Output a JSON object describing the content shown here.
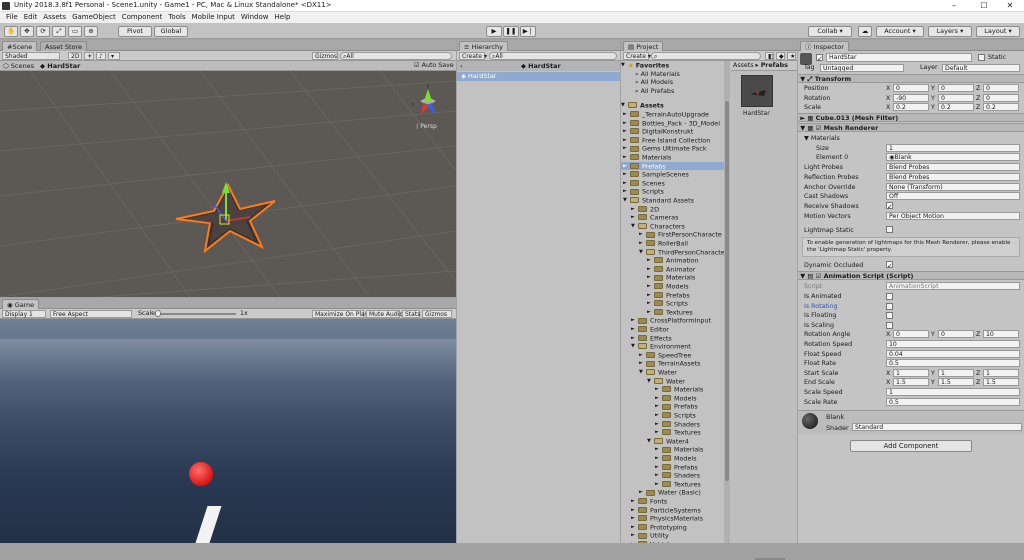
{
  "window": {
    "title": "Unity 2018.3.8f1 Personal - Scene1.unity - Game1 - PC, Mac & Linux Standalone* <DX11>"
  },
  "menu": [
    "File",
    "Edit",
    "Assets",
    "GameObject",
    "Component",
    "Tools",
    "Mobile Input",
    "Window",
    "Help"
  ],
  "toolbar": {
    "pivot": "Pivot",
    "global": "Global",
    "collab": "Collab",
    "account": "Account",
    "layers": "Layers",
    "layout": "Layout"
  },
  "scene": {
    "tab_scene": "Scene",
    "tab_asset_store": "Asset Store",
    "shaded": "Shaded",
    "mode_2d": "2D",
    "gizmos": "Gizmos",
    "search": "All",
    "scenes": "Scenes",
    "breadcrumb": "HardStar",
    "auto_save": "Auto Save",
    "persp": "Persp",
    "axis_y": "y",
    "axis_x": "x"
  },
  "game": {
    "tab": "Game",
    "display": "Display 1",
    "aspect": "Free Aspect",
    "scale_label": "Scale",
    "scale_value": "1x",
    "maximize": "Maximize On Play",
    "mute": "Mute Audio",
    "stats": "Stats",
    "gizmos": "Gizmos"
  },
  "hierarchy": {
    "tab": "Hierarchy",
    "create": "Create",
    "search": "All",
    "scene_name": "HardStar",
    "item": "HardStar"
  },
  "project": {
    "tab": "Project",
    "create": "Create",
    "favorites": "Favorites",
    "fav_items": [
      "All Materials",
      "All Models",
      "All Prefabs"
    ],
    "assets": "Assets",
    "tree": [
      {
        "l": "_TerrainAutoUpgrade",
        "d": 1
      },
      {
        "l": "Bottles_Pack - 3D_Model",
        "d": 1
      },
      {
        "l": "DigitalKonstrukt",
        "d": 1
      },
      {
        "l": "Free Island Collection",
        "d": 1
      },
      {
        "l": "Gems Ultimate Pack",
        "d": 1
      },
      {
        "l": "Materials",
        "d": 1
      },
      {
        "l": "Prefabs",
        "d": 1,
        "sel": true
      },
      {
        "l": "SampleScenes",
        "d": 1
      },
      {
        "l": "Scenes",
        "d": 1
      },
      {
        "l": "Scripts",
        "d": 1
      },
      {
        "l": "Standard Assets",
        "d": 1,
        "open": true
      },
      {
        "l": "2D",
        "d": 2
      },
      {
        "l": "Cameras",
        "d": 2
      },
      {
        "l": "Characters",
        "d": 2,
        "open": true
      },
      {
        "l": "FirstPersonCharacte",
        "d": 3
      },
      {
        "l": "RollerBall",
        "d": 3
      },
      {
        "l": "ThirdPersonCharacte",
        "d": 3,
        "open": true
      },
      {
        "l": "Animation",
        "d": 4
      },
      {
        "l": "Animator",
        "d": 4
      },
      {
        "l": "Materials",
        "d": 4
      },
      {
        "l": "Models",
        "d": 4
      },
      {
        "l": "Prefabs",
        "d": 4
      },
      {
        "l": "Scripts",
        "d": 4
      },
      {
        "l": "Textures",
        "d": 4
      },
      {
        "l": "CrossPlatformInput",
        "d": 2
      },
      {
        "l": "Editor",
        "d": 2
      },
      {
        "l": "Effects",
        "d": 2
      },
      {
        "l": "Environment",
        "d": 2,
        "open": true
      },
      {
        "l": "SpeedTree",
        "d": 3
      },
      {
        "l": "TerrainAssets",
        "d": 3
      },
      {
        "l": "Water",
        "d": 3,
        "open": true
      },
      {
        "l": "Water",
        "d": 4,
        "open": true
      },
      {
        "l": "Materials",
        "d": 5
      },
      {
        "l": "Models",
        "d": 5
      },
      {
        "l": "Prefabs",
        "d": 5
      },
      {
        "l": "Scripts",
        "d": 5
      },
      {
        "l": "Shaders",
        "d": 5
      },
      {
        "l": "Textures",
        "d": 5
      },
      {
        "l": "Water4",
        "d": 4,
        "open": true
      },
      {
        "l": "Materials",
        "d": 5
      },
      {
        "l": "Models",
        "d": 5
      },
      {
        "l": "Prefabs",
        "d": 5
      },
      {
        "l": "Shaders",
        "d": 5
      },
      {
        "l": "Textures",
        "d": 5
      },
      {
        "l": "Water (Basic)",
        "d": 3
      },
      {
        "l": "Fonts",
        "d": 2
      },
      {
        "l": "ParticleSystems",
        "d": 2
      },
      {
        "l": "PhysicsMaterials",
        "d": 2
      },
      {
        "l": "Prototyping",
        "d": 2
      },
      {
        "l": "Utility",
        "d": 2
      },
      {
        "l": "Vehicles",
        "d": 2
      }
    ],
    "crumb_assets": "Assets",
    "crumb_prefabs": "Prefabs",
    "asset_name": "HardStar"
  },
  "inspector": {
    "tab": "Inspector",
    "object_name": "HardStar",
    "static": "Static",
    "tag_label": "Tag",
    "tag": "Untagged",
    "layer_label": "Layer",
    "layer": "Default",
    "transform": "Transform",
    "position": "Position",
    "rotation": "Rotation",
    "scale": "Scale",
    "pos": [
      "0",
      "0",
      "0"
    ],
    "rot": [
      "-90",
      "0",
      "0"
    ],
    "scl": [
      "0.2",
      "0.2",
      "0.2"
    ],
    "mesh_filter": "Cube.013 (Mesh Filter)",
    "mesh_renderer": "Mesh Renderer",
    "materials": "Materials",
    "size_label": "Size",
    "size": "1",
    "element0_label": "Element 0",
    "element0": "Blank",
    "light_probes_label": "Light Probes",
    "light_probes": "Blend Probes",
    "reflection_probes_label": "Reflection Probes",
    "reflection_probes": "Blend Probes",
    "anchor_label": "Anchor Override",
    "anchor": "None (Transform)",
    "cast_label": "Cast Shadows",
    "cast": "Off",
    "receive_label": "Receive Shadows",
    "motion_label": "Motion Vectors",
    "motion": "Per Object Motion",
    "lightmap_label": "Lightmap Static",
    "lightmap_info": "To enable generation of lightmaps for this Mesh Renderer, please enable the 'Lightmap Static' property.",
    "dynamic_label": "Dynamic Occluded",
    "anim_script": "Animation Script (Script)",
    "script_label": "Script",
    "script": "AnimationScript",
    "is_animated": "Is Animated",
    "is_rotating": "Is Rotating",
    "is_floating": "Is Floating",
    "is_scaling": "Is Scaling",
    "rotation_angle": "Rotation Angle",
    "rot_angle": [
      "0",
      "0",
      "10"
    ],
    "rotation_speed": "Rotation Speed",
    "rot_speed": "10",
    "float_speed": "Float Speed",
    "float_speed_v": "0.04",
    "float_rate": "Float Rate",
    "float_rate_v": "0.5",
    "start_scale": "Start Scale",
    "start_scl": [
      "1",
      "1",
      "1"
    ],
    "end_scale": "End Scale",
    "end_scl": [
      "1.5",
      "1.5",
      "1.5"
    ],
    "scale_speed": "Scale Speed",
    "scale_speed_v": "1",
    "scale_rate": "Scale Rate",
    "scale_rate_v": "0.5",
    "material_name": "Blank",
    "shader_label": "Shader",
    "shader": "Standard",
    "add_component": "Add Component"
  }
}
